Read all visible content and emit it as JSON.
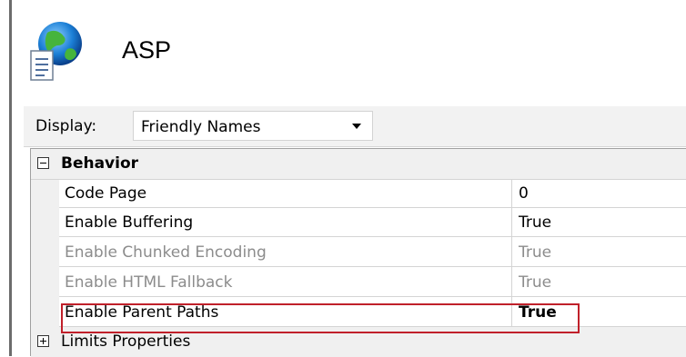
{
  "feature": {
    "title": "ASP",
    "icon": "asp-globe-document-icon"
  },
  "display": {
    "label": "Display:",
    "selected": "Friendly Names"
  },
  "grid": {
    "categories": [
      {
        "label": "Behavior",
        "expanded": true,
        "rows": [
          {
            "name": "Code Page",
            "value": "0"
          },
          {
            "name": "Enable Buffering",
            "value": "True"
          },
          {
            "name": "Enable Chunked Encoding",
            "value": "True",
            "disabled": true
          },
          {
            "name": "Enable HTML Fallback",
            "value": "True",
            "disabled": true
          },
          {
            "name": "Enable Parent Paths",
            "value": "True",
            "bold": true
          }
        ]
      },
      {
        "label": "Limits Properties",
        "expanded": false
      }
    ]
  },
  "colors": {
    "highlight": "#c0202a",
    "category_bg": "#f0f0f0",
    "disabled_text": "#8c8c8c"
  }
}
